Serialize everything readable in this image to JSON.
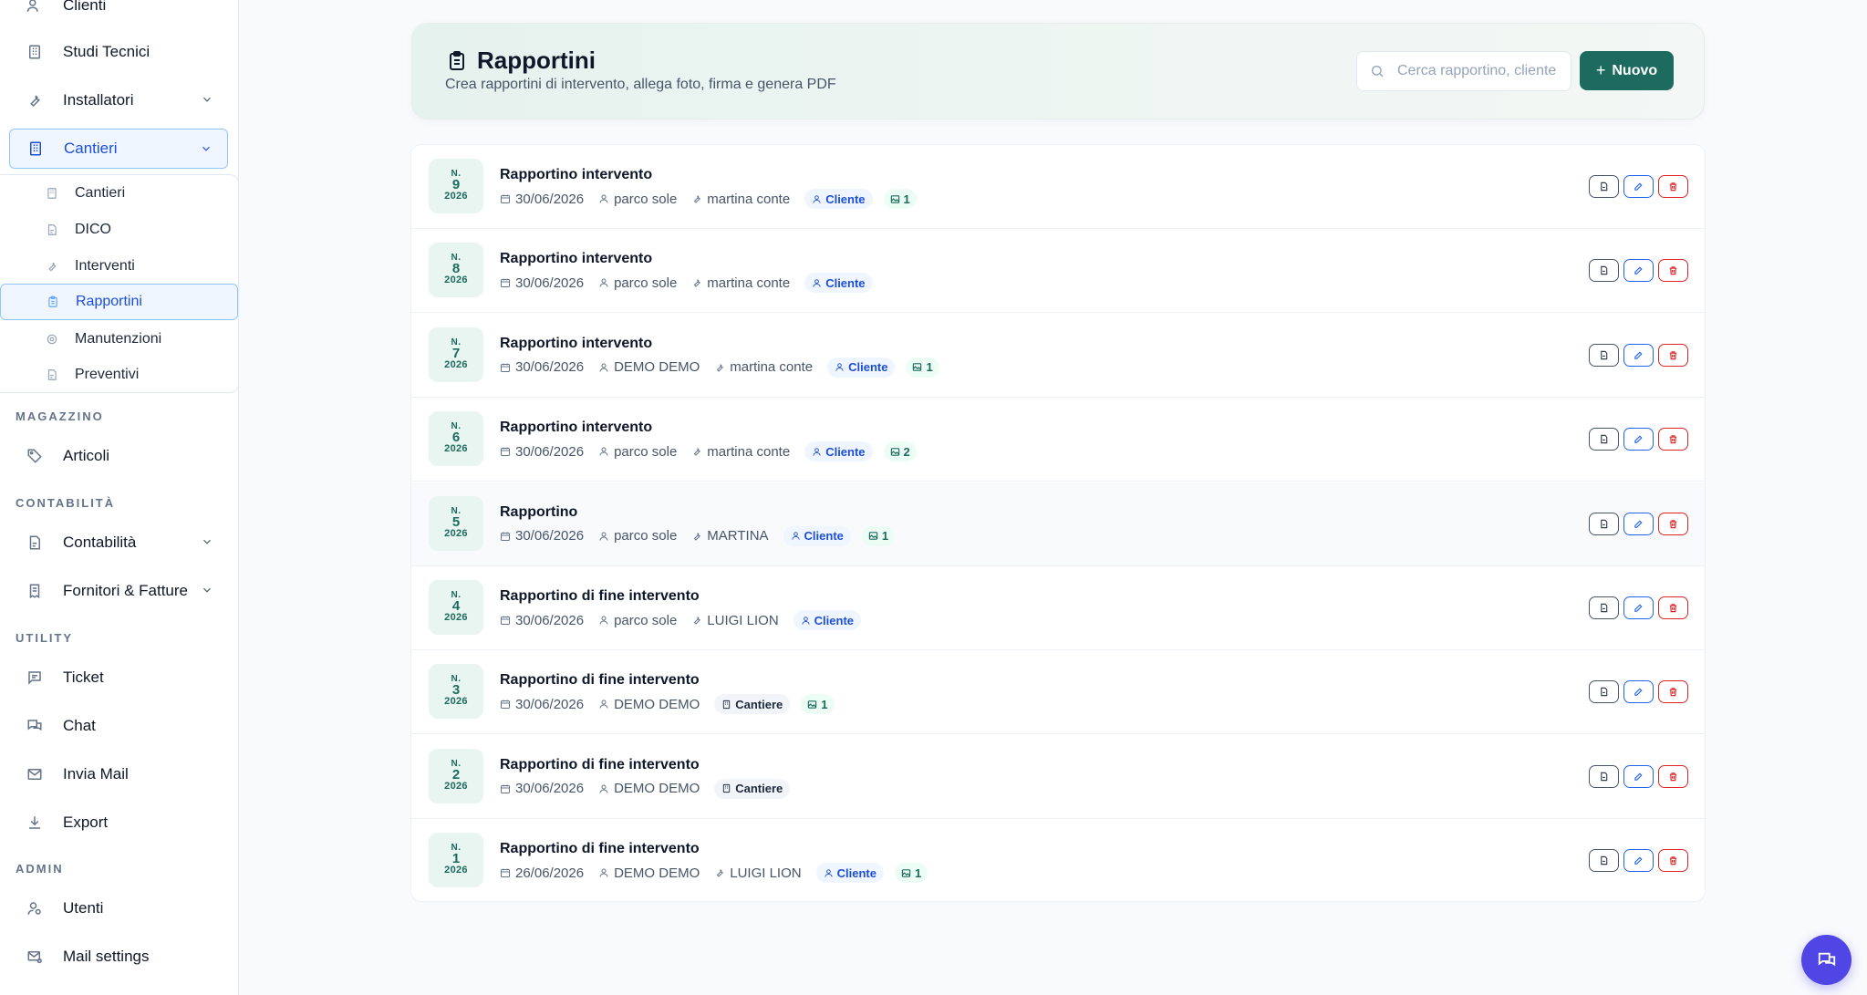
{
  "sidebar": {
    "top_items": [
      {
        "label": "Clienti",
        "icon": "users-icon"
      },
      {
        "label": "Studi Tecnici",
        "icon": "building-icon"
      },
      {
        "label": "Installatori",
        "icon": "wrench-icon"
      },
      {
        "label": "Cantieri",
        "icon": "building-icon"
      }
    ],
    "cantieri_sub": [
      {
        "label": "Cantieri",
        "icon": "building-icon"
      },
      {
        "label": "DICO",
        "icon": "document-icon"
      },
      {
        "label": "Interventi",
        "icon": "wrench-icon"
      },
      {
        "label": "Rapportini",
        "icon": "clipboard-icon"
      },
      {
        "label": "Manutenzioni",
        "icon": "gear-icon"
      },
      {
        "label": "Preventivi",
        "icon": "document-icon"
      }
    ],
    "sections": {
      "magazzino": "MAGAZZINO",
      "contabilita": "CONTABILITÀ",
      "utility": "UTILITY",
      "admin": "ADMIN"
    },
    "magazzino_items": [
      {
        "label": "Articoli",
        "icon": "tag-icon"
      }
    ],
    "contabilita_items": [
      {
        "label": "Contabilità",
        "icon": "document-icon"
      },
      {
        "label": "Fornitori & Fatture",
        "icon": "receipt-icon"
      }
    ],
    "utility_items": [
      {
        "label": "Ticket",
        "icon": "message-icon"
      },
      {
        "label": "Chat",
        "icon": "chat-icon"
      },
      {
        "label": "Invia Mail",
        "icon": "mail-icon"
      },
      {
        "label": "Export",
        "icon": "download-icon"
      }
    ],
    "admin_items": [
      {
        "label": "Utenti",
        "icon": "user-gear-icon"
      },
      {
        "label": "Mail settings",
        "icon": "mail-settings-icon"
      }
    ]
  },
  "header": {
    "title": "Rapportini",
    "subtitle": "Crea rapportini di intervento, allega foto, firma e genera PDF",
    "search_placeholder": "Cerca rapportino, cliente",
    "new_label": "Nuovo",
    "new_plus": "+"
  },
  "rapportini": [
    {
      "num_prefix": "N.",
      "number": "9",
      "year": "2026",
      "title": "Rapportino intervento",
      "date": "30/06/2026",
      "client": "parco sole",
      "installer": "martina conte",
      "tag": "Cliente",
      "photos": "1"
    },
    {
      "num_prefix": "N.",
      "number": "8",
      "year": "2026",
      "title": "Rapportino intervento",
      "date": "30/06/2026",
      "client": "parco sole",
      "installer": "martina conte",
      "tag": "Cliente",
      "photos": ""
    },
    {
      "num_prefix": "N.",
      "number": "7",
      "year": "2026",
      "title": "Rapportino intervento",
      "date": "30/06/2026",
      "client": "DEMO DEMO",
      "installer": "martina conte",
      "tag": "Cliente",
      "photos": "1"
    },
    {
      "num_prefix": "N.",
      "number": "6",
      "year": "2026",
      "title": "Rapportino intervento",
      "date": "30/06/2026",
      "client": "parco sole",
      "installer": "martina conte",
      "tag": "Cliente",
      "photos": "2"
    },
    {
      "num_prefix": "N.",
      "number": "5",
      "year": "2026",
      "title": "Rapportino",
      "date": "30/06/2026",
      "client": "parco sole",
      "installer": "MARTINA",
      "tag": "Cliente",
      "photos": "1"
    },
    {
      "num_prefix": "N.",
      "number": "4",
      "year": "2026",
      "title": "Rapportino di fine intervento",
      "date": "30/06/2026",
      "client": "parco sole",
      "installer": "LUIGI LION",
      "tag": "Cliente",
      "photos": ""
    },
    {
      "num_prefix": "N.",
      "number": "3",
      "year": "2026",
      "title": "Rapportino di fine intervento",
      "date": "30/06/2026",
      "client": "DEMO DEMO",
      "installer": "",
      "tag": "Cantiere",
      "photos": "1"
    },
    {
      "num_prefix": "N.",
      "number": "2",
      "year": "2026",
      "title": "Rapportino di fine intervento",
      "date": "30/06/2026",
      "client": "DEMO DEMO",
      "installer": "",
      "tag": "Cantiere",
      "photos": ""
    },
    {
      "num_prefix": "N.",
      "number": "1",
      "year": "2026",
      "title": "Rapportino di fine intervento",
      "date": "26/06/2026",
      "client": "DEMO DEMO",
      "installer": "LUIGI LION",
      "tag": "Cliente",
      "photos": "1"
    }
  ],
  "colors": {
    "accent": "#1d6b5e",
    "active_blue": "#1d4ed8",
    "delete_red": "#dc2626",
    "fab": "#4f46e5"
  }
}
